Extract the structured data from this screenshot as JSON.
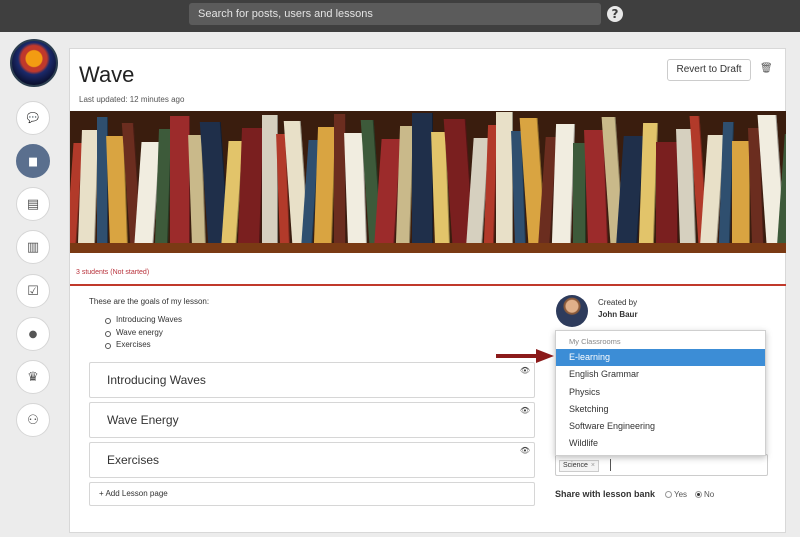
{
  "topbar": {
    "search_placeholder": "Search for posts, users and lessons",
    "help_label": "?"
  },
  "sidebar": {
    "items": [
      {
        "icon": "chat-icon",
        "glyph": "💬"
      },
      {
        "icon": "folder-icon",
        "glyph": "▆",
        "active": true
      },
      {
        "icon": "newspaper-icon",
        "glyph": "▤"
      },
      {
        "icon": "bar-chart-icon",
        "glyph": "▥"
      },
      {
        "icon": "checkbox-icon",
        "glyph": "☑"
      },
      {
        "icon": "user-icon",
        "glyph": "●"
      },
      {
        "icon": "trophy-icon",
        "glyph": "♛"
      },
      {
        "icon": "group-icon",
        "glyph": "⚇"
      }
    ]
  },
  "lesson": {
    "title": "Wave",
    "last_updated": "Last updated: 12 minutes ago",
    "revert_label": "Revert to Draft",
    "students_status": "3 students (Not started)",
    "goals_intro": "These are the goals of my lesson:",
    "goals": [
      "Introducing Waves",
      "Wave energy",
      "Exercises"
    ],
    "pages": [
      {
        "label": "Introducing Waves"
      },
      {
        "label": "Wave Energy"
      },
      {
        "label": "Exercises"
      }
    ],
    "add_page_label": "+ Add Lesson page"
  },
  "author": {
    "created_by_label": "Created by",
    "name": "John Baur"
  },
  "classroom_dropdown": {
    "header": "My Classrooms",
    "items": [
      "E-learning",
      "English Grammar",
      "Physics",
      "Sketching",
      "Software Engineering",
      "Wildlife"
    ],
    "highlighted": "E-learning"
  },
  "tags": {
    "items": [
      {
        "label": "Science",
        "remove": "×"
      }
    ]
  },
  "share": {
    "label": "Share with lesson bank",
    "yes_label": "Yes",
    "no_label": "No",
    "selected": "No"
  },
  "colors": {
    "accent_red": "#c0392b",
    "dropdown_highlight": "#3c8dd6",
    "sidebar_active": "#5a6f8e",
    "arrow": "#8b1a1a"
  }
}
